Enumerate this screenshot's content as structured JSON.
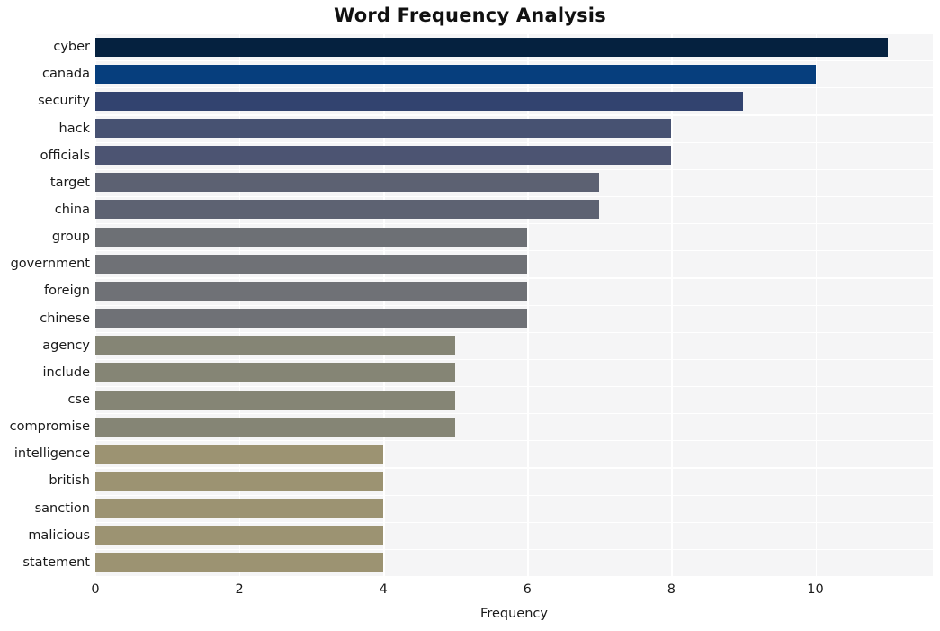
{
  "chart_data": {
    "type": "bar",
    "orientation": "horizontal",
    "title": "Word Frequency Analysis",
    "xlabel": "Frequency",
    "ylabel": "",
    "categories": [
      "cyber",
      "canada",
      "security",
      "hack",
      "officials",
      "target",
      "china",
      "group",
      "government",
      "foreign",
      "chinese",
      "agency",
      "include",
      "cse",
      "compromise",
      "intelligence",
      "british",
      "sanction",
      "malicious",
      "statement"
    ],
    "values": [
      11,
      10,
      9,
      8,
      8,
      7,
      7,
      6,
      6,
      6,
      6,
      5,
      5,
      5,
      5,
      4,
      4,
      4,
      4,
      4
    ],
    "bar_colors": [
      "#05213f",
      "#063e7d",
      "#32436f",
      "#475272",
      "#4c5472",
      "#5c6172",
      "#5d6272",
      "#6d7075",
      "#6f7176",
      "#6f7176",
      "#6f7176",
      "#858575",
      "#858575",
      "#858575",
      "#858575",
      "#9c9372",
      "#9c9372",
      "#9c9372",
      "#9c9372",
      "#9c9372"
    ],
    "xlim": [
      0,
      11.63
    ],
    "xticks": [
      0,
      2,
      4,
      6,
      8,
      10
    ],
    "xtick_labels": [
      "0",
      "2",
      "4",
      "6",
      "8",
      "10"
    ],
    "grid": true,
    "grid_color": "#ffffff",
    "plot_background": "#f5f5f6",
    "figure_background": "#ffffff",
    "legend": null
  }
}
